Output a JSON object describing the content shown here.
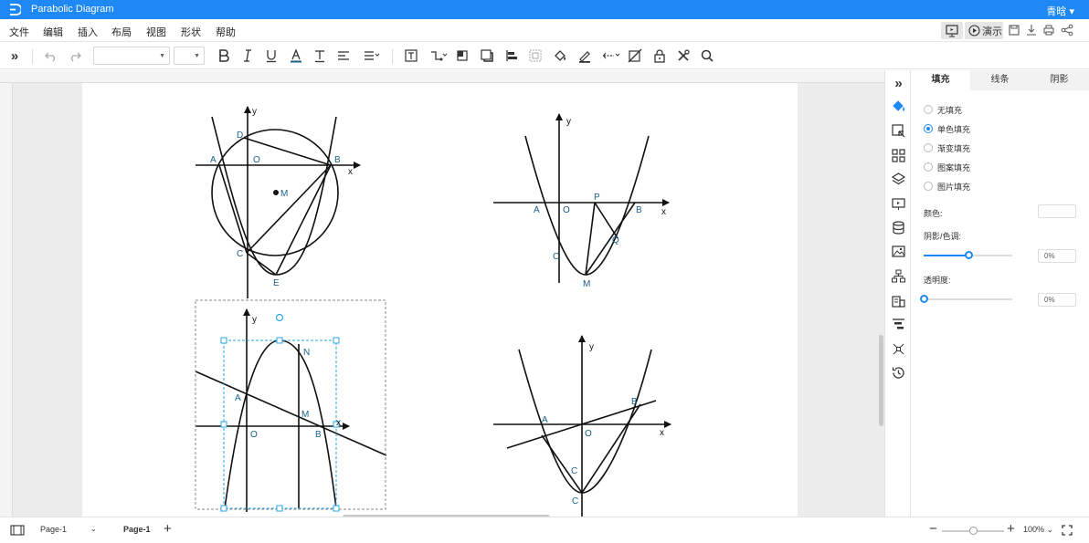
{
  "app": {
    "title": "Parabolic Diagram",
    "user": "青晗",
    "colors": {
      "brand": "#1e88f5",
      "label": "#1a5f8a",
      "selection": "#2aa6e8"
    }
  },
  "menu": {
    "items": [
      "文件",
      "编辑",
      "插入",
      "布局",
      "视图",
      "形状",
      "帮助"
    ],
    "present_label": "演示"
  },
  "toolbar": {
    "font_family_value": "",
    "font_size_value": ""
  },
  "diagrams": {
    "d1": {
      "y": "y",
      "x": "x",
      "D": "D",
      "A": "A",
      "O": "O",
      "B": "B",
      "M": "M",
      "C": "C",
      "E": "E"
    },
    "d2": {
      "y": "y",
      "x": "x",
      "A": "A",
      "O": "O",
      "P": "P",
      "B": "B",
      "Q": "Q",
      "C": "C",
      "M": "M"
    },
    "d3": {
      "y": "y",
      "x": "x",
      "N": "N",
      "A": "A",
      "M": "M",
      "O": "O",
      "B": "B"
    },
    "d4": {
      "y": "y",
      "x": "x",
      "B": "B",
      "A": "A",
      "O": "O",
      "C1": "C",
      "C2": "C"
    }
  },
  "panel": {
    "tabs": [
      "填充",
      "线条",
      "阴影"
    ],
    "active_tab": "填充",
    "fill_options": [
      "无填充",
      "单色填充",
      "渐变填充",
      "图案填充",
      "图片填充"
    ],
    "selected_fill": "单色填充",
    "color_label": "颜色:",
    "shade_label": "阴影/色调:",
    "shade_value": "0%",
    "shade_level": 0.5,
    "opacity_label": "透明度:",
    "opacity_value": "0%",
    "opacity_level": 0
  },
  "statusbar": {
    "page_selector": "Page-1",
    "page_tab": "Page-1",
    "zoom": "100%",
    "zoom_level": 0.5
  }
}
